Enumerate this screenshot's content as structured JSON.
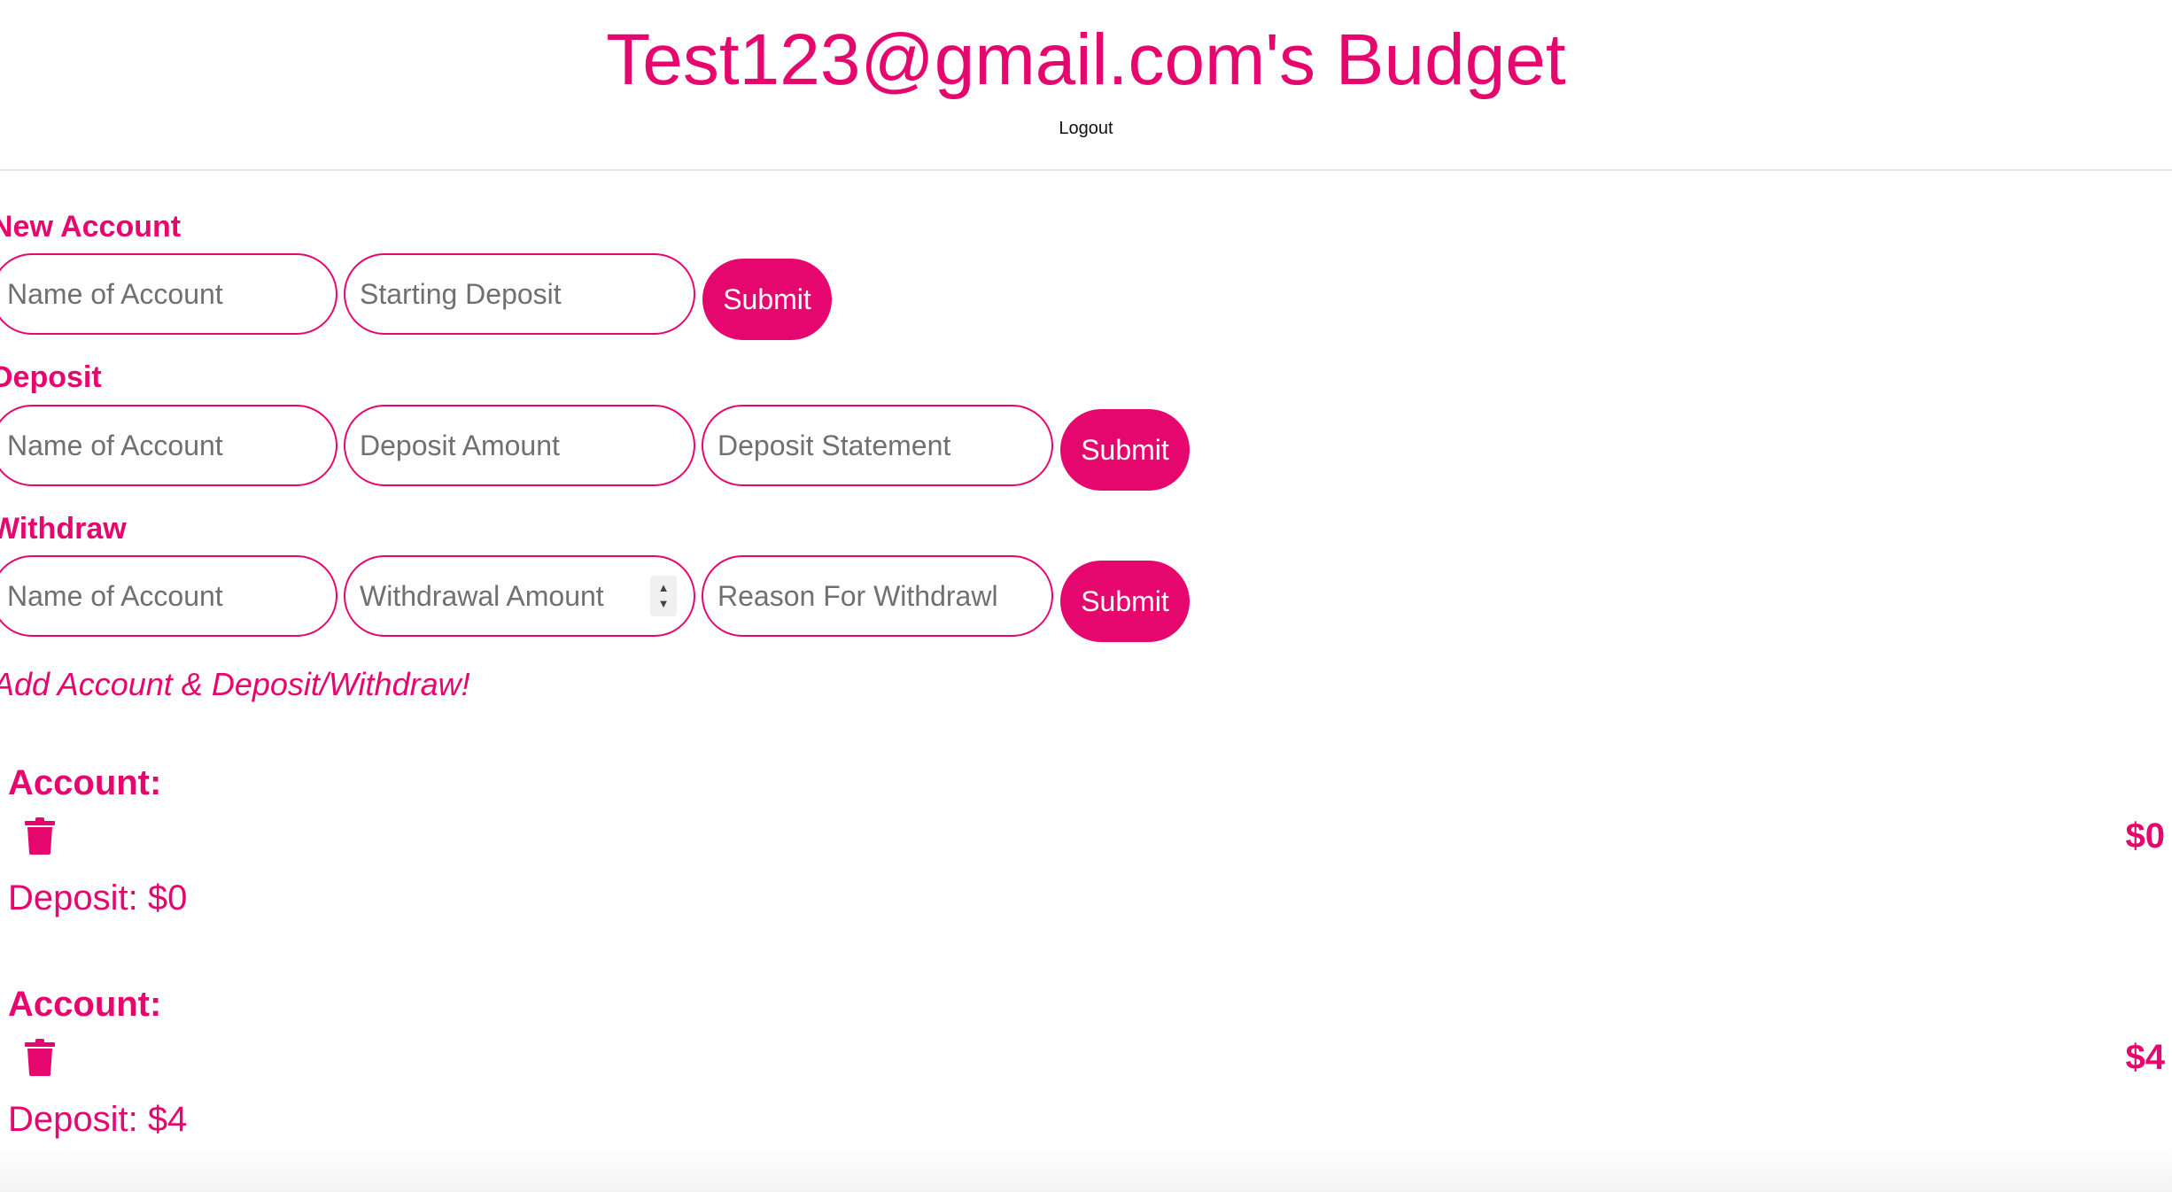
{
  "header": {
    "title": "Test123@gmail.com's Budget",
    "logout_label": "Logout"
  },
  "forms": {
    "new_account": {
      "label": "New Account",
      "name_placeholder": "Name of Account",
      "amount_placeholder": "Starting Deposit",
      "submit_label": "Submit"
    },
    "deposit": {
      "label": "Deposit",
      "name_placeholder": "Name of Account",
      "amount_placeholder": "Deposit Amount",
      "statement_placeholder": "Deposit Statement",
      "submit_label": "Submit"
    },
    "withdraw": {
      "label": "Withdraw",
      "name_placeholder": "Name of Account",
      "amount_placeholder": "Withdrawal Amount",
      "reason_placeholder": "Reason For Withdrawl",
      "submit_label": "Submit"
    }
  },
  "hint": "Add Account & Deposit/Withdraw!",
  "accounts": [
    {
      "title": "Account:",
      "icon": "trash-icon",
      "deposit_text": "Deposit: $0",
      "balance": "$0"
    },
    {
      "title": "Account:",
      "icon": "trash-icon",
      "deposit_text": "Deposit: $4",
      "balance": "$4"
    }
  ],
  "colors": {
    "accent": "#e6076e",
    "placeholder": "#707070"
  }
}
